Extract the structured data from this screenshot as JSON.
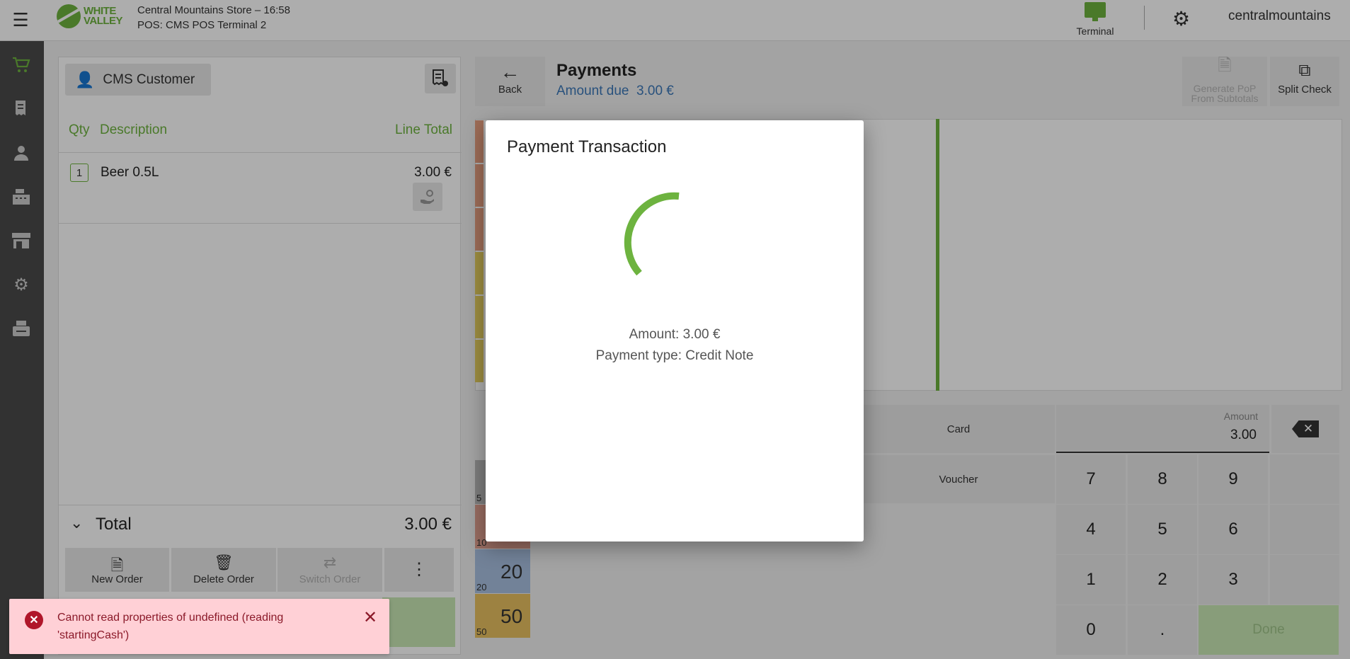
{
  "header": {
    "store_line": "Central Mountains Store – 16:58",
    "pos_line": "POS: CMS POS Terminal 2",
    "logo_line1": "WHITE",
    "logo_line2": "VALLEY",
    "terminal_label": "Terminal",
    "username": "centralmountains"
  },
  "sidebar": {
    "items": [
      {
        "name": "cart-icon",
        "active": true
      },
      {
        "name": "receipts-icon",
        "active": false
      },
      {
        "name": "customer-icon",
        "active": false
      },
      {
        "name": "cash-register-icon",
        "active": false
      },
      {
        "name": "store-icon",
        "active": false
      },
      {
        "name": "settings-icon",
        "active": false
      },
      {
        "name": "printer-icon",
        "active": false
      }
    ]
  },
  "order": {
    "customer_label": "CMS Customer",
    "col_qty": "Qty",
    "col_desc": "Description",
    "col_total": "Line Total",
    "lines": [
      {
        "qty": "1",
        "desc": "Beer 0.5L",
        "total": "3.00 €"
      }
    ],
    "total_label": "Total",
    "total_value": "3.00 €",
    "buttons": {
      "new_order": "New Order",
      "delete_order": "Delete Order",
      "switch_order": "Switch Order",
      "more": "⋮"
    }
  },
  "payments": {
    "back_label": "Back",
    "title": "Payments",
    "amount_due_label": "Amount due",
    "amount_due_value": "3.00 €",
    "generate_pop_line1": "Generate PoP",
    "generate_pop_line2": "From Subtotals",
    "split_check": "Split Check",
    "methods": {
      "card": "Card",
      "voucher": "Voucher"
    },
    "amount_label": "Amount",
    "amount_value": "3.00",
    "keys": [
      "7",
      "8",
      "9",
      "4",
      "5",
      "6",
      "1",
      "2",
      "3",
      "0",
      "."
    ],
    "done": "Done",
    "notes": [
      {
        "value": "5",
        "label": "5"
      },
      {
        "value": "10",
        "label": "10"
      },
      {
        "value": "20",
        "label": "20"
      },
      {
        "value": "50",
        "label": "50"
      }
    ]
  },
  "modal": {
    "title": "Payment Transaction",
    "amount_line": "Amount: 3.00 €",
    "type_line": "Payment type: Credit Note"
  },
  "toast": {
    "message": "Cannot read properties of undefined (reading 'startingCash')"
  },
  "colors": {
    "accent": "#6db33f",
    "link": "#3c78b8",
    "error": "#b0162a",
    "error_bg": "#ffd0d6"
  }
}
